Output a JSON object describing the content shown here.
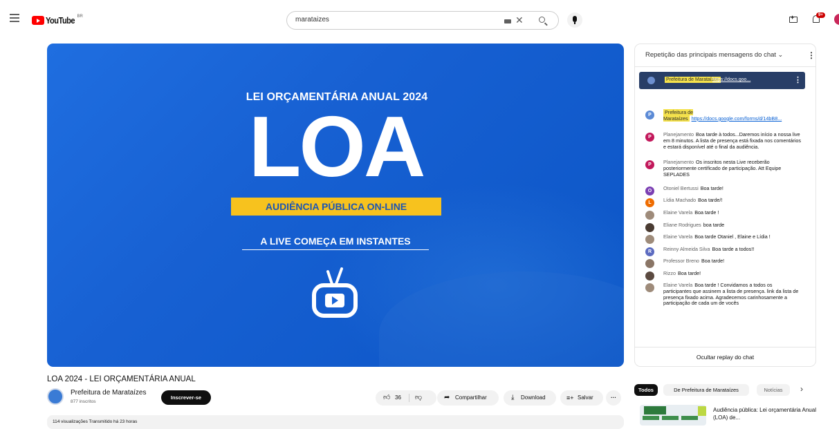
{
  "header": {
    "logo_text": "YouTube",
    "logo_country": "BR",
    "search_value": "marataizes",
    "notification_count": "9+"
  },
  "player": {
    "slide_top": "LEI ORÇAMENTÁRIA ANUAL 2024",
    "slide_big": "LOA",
    "slide_banner": "AUDIÊNCIA PÚBLICA ON-LINE",
    "slide_sub": "A LIVE COMEÇA EM INSTANTES",
    "background_color": "#1a66d8",
    "banner_color": "#f7c21e"
  },
  "chat": {
    "header_title": "Repetição das principais mensagens do chat",
    "pinned": {
      "author": "Prefeitura de Marataízes",
      "text": "https://docs.goo..."
    },
    "messages": [
      {
        "avatar": "P",
        "avatar_color": "#5b8ad6",
        "author": "Prefeitura de Marataízes",
        "highlight": true,
        "text": "",
        "link": "https://docs.google.com/forms/d/14bB8..."
      },
      {
        "avatar": "P",
        "avatar_color": "#c2185b",
        "author": "Planejamento",
        "highlight": false,
        "text": "Boa tarde à todos...Daremos início a nossa live em 8 minutos. A lista de presença está fixada nos comentários e estará disponível até o final da audiência.",
        "link": ""
      },
      {
        "avatar": "P",
        "avatar_color": "#c2185b",
        "author": "Planejamento",
        "highlight": false,
        "text": "Os inscritos nesta Live receberão posteriormente certificado de participação. Att Equipe SEPLADES",
        "link": ""
      },
      {
        "avatar": "O",
        "avatar_color": "#7b3fb3",
        "author": "Otoniel Bertussi",
        "highlight": false,
        "text": "Boa tarde!",
        "link": ""
      },
      {
        "avatar": "L",
        "avatar_color": "#ef6c00",
        "author": "Lídia Machado",
        "highlight": false,
        "text": "Boa tarde/!",
        "link": ""
      },
      {
        "avatar": "",
        "avatar_color": "#9e8b7a",
        "author": "Elaine Varela",
        "highlight": false,
        "text": "Boa tarde !",
        "link": ""
      },
      {
        "avatar": "",
        "avatar_color": "#4a3b32",
        "author": "Eliane Rodrigues",
        "highlight": false,
        "text": "boa tarde",
        "link": ""
      },
      {
        "avatar": "",
        "avatar_color": "#9e8b7a",
        "author": "Elaine Varela",
        "highlight": false,
        "text": "Boa tarde Otaniel , Elaine e Lídia !",
        "link": ""
      },
      {
        "avatar": "R",
        "avatar_color": "#5c6bc0",
        "author": "Reinny Almeida Silva",
        "highlight": false,
        "text": "Boa tarde a todos!!",
        "link": ""
      },
      {
        "avatar": "",
        "avatar_color": "#8a7566",
        "author": "Professor Breno",
        "highlight": false,
        "text": "Boa tarde!",
        "link": ""
      },
      {
        "avatar": "",
        "avatar_color": "#5b4a40",
        "author": "Rizzo",
        "highlight": false,
        "text": "Boa tarde!",
        "link": ""
      },
      {
        "avatar": "",
        "avatar_color": "#9e8b7a",
        "author": "Elaine Varela",
        "highlight": false,
        "text": "Boa tarde ! Convidamos a todos os participantes que assinem a lista de presença. link da lista de presença fixado acima. Agradecemos carinhosamente a participação de cada um de vocês",
        "link": ""
      }
    ],
    "hide_label": "Ocultar replay do chat"
  },
  "video": {
    "title": "LOA 2024 - LEI ORÇAMENTÁRIA ANUAL",
    "channel_name": "Prefeitura de Marataízes",
    "subscribers": "877 inscritos",
    "subscribe_label": "Inscrever-se",
    "likes": "36",
    "share_label": "Compartilhar",
    "download_label": "Download",
    "save_label": "Salvar",
    "more_label": "···",
    "description_meta": "114 visualizações  Transmitido há 23 horas"
  },
  "related": {
    "chips": [
      "Todos",
      "De Prefeitura de Marataízes",
      "Notícias"
    ],
    "items": [
      {
        "title": "Audiência pública: Lei orçamentária Anual (LOA) de..."
      }
    ]
  }
}
